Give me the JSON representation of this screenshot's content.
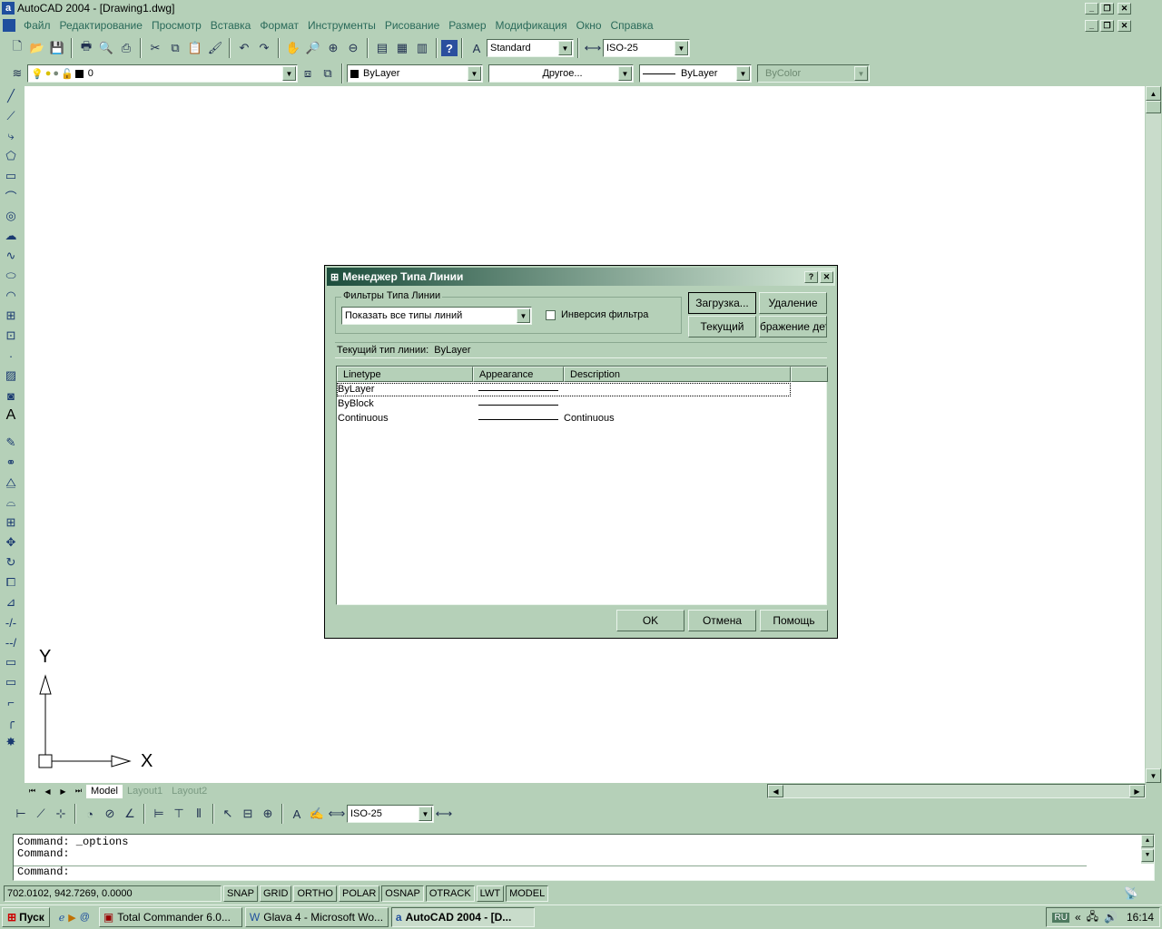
{
  "window": {
    "title": "AutoCAD 2004 - [Drawing1.dwg]",
    "logo": "a",
    "controls": [
      "minimize-icon",
      "restore-icon",
      "close-icon"
    ]
  },
  "menu": [
    "Файл",
    "Редактирование",
    "Просмотр",
    "Вставка",
    "Формат",
    "Инструменты",
    "Рисование",
    "Размер",
    "Модификация",
    "Окно",
    "Справка"
  ],
  "toolbar": {
    "text_style": "Standard",
    "dim_style": "ISO-25"
  },
  "layers": {
    "current_layer": "0",
    "color": "ByLayer",
    "linetype_combo": "Другое...",
    "lineweight": "ByLayer",
    "plotstyle": "ByColor"
  },
  "ucs": {
    "y_label": "Y",
    "x_label": "X"
  },
  "tabs": [
    "Model",
    "Layout1",
    "Layout2"
  ],
  "dimension_toolbar": {
    "dim_style": "ISO-25"
  },
  "command": {
    "lines": [
      "Command: _options",
      "Command:"
    ],
    "prompt": "Command:"
  },
  "status": {
    "coords": "702.0102, 942.7269, 0.0000",
    "buttons": [
      "SNAP",
      "GRID",
      "ORTHO",
      "POLAR",
      "OSNAP",
      "OTRACK",
      "LWT",
      "MODEL"
    ]
  },
  "taskbar": {
    "start": "Пуск",
    "tasks": [
      "Total Commander 6.0...",
      "Glava 4 - Microsoft Wo...",
      "AutoCAD 2004 - [D..."
    ],
    "lang": "RU",
    "time": "16:14"
  },
  "dialog": {
    "title": "Менеджер Типа Линии",
    "help_btn": "?",
    "close_btn": "✕",
    "filter_group": "Фильтры Типа Линии",
    "filter_value": "Показать все типы линий",
    "invert_label": "Инверсия фильтра",
    "load_btn": "Загрузка...",
    "delete_btn": "Удаление",
    "current_btn": "Текущий",
    "details_btn": "бражение дета",
    "current_linetype_label": "Текущий тип линии:",
    "current_linetype_value": "ByLayer",
    "columns": [
      "Linetype",
      "Appearance",
      "Description"
    ],
    "rows": [
      {
        "name": "ByLayer",
        "description": ""
      },
      {
        "name": "ByBlock",
        "description": ""
      },
      {
        "name": "Continuous",
        "description": "Continuous"
      }
    ],
    "ok_btn": "OK",
    "cancel_btn": "Отмена",
    "help_button": "Помощь"
  }
}
